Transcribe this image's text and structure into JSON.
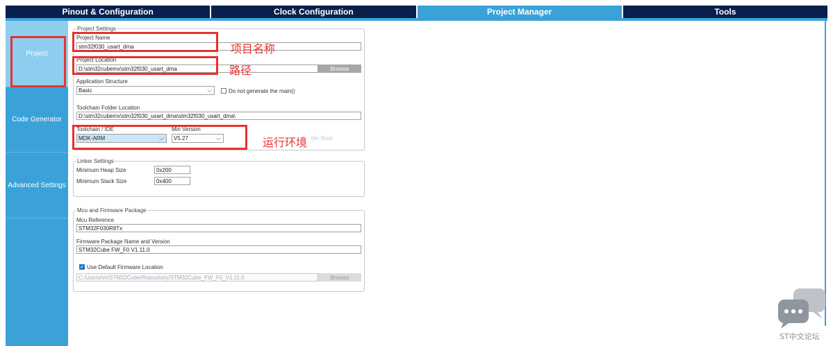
{
  "tabs": [
    {
      "label": "Pinout & Configuration"
    },
    {
      "label": "Clock Configuration"
    },
    {
      "label": "Project Manager"
    },
    {
      "label": "Tools"
    }
  ],
  "sidebar": {
    "items": [
      {
        "label": "Project"
      },
      {
        "label": "Code Generator"
      },
      {
        "label": "Advanced Settings"
      }
    ]
  },
  "project_settings": {
    "legend": "Project Settings",
    "name_label": "Project Name",
    "name_value": "stm32f030_usart_dma",
    "location_label": "Project Location",
    "location_value": "D:\\stm32cubemx\\stm32f030_usart_dma",
    "browse_label": "Browse",
    "app_structure_label": "Application Structure",
    "app_structure_value": "Basic",
    "no_main_label": "Do not generate the main()",
    "toolchain_folder_label": "Toolchain Folder Location",
    "toolchain_folder_value": "D:\\stm32cubemx\\stm32f030_usart_dma\\stm32f030_usart_dma\\",
    "toolchain_label": "Toolchain / IDE",
    "toolchain_value": "MDK-ARM",
    "min_version_label": "Min Version",
    "min_version_value": "V5.27",
    "generate_root_label": "der Root"
  },
  "linker_settings": {
    "legend": "Linker Settings",
    "heap_label": "Minimum Heap Size",
    "heap_value": "0x200",
    "stack_label": "Minimum Stack Size",
    "stack_value": "0x400"
  },
  "mcu_firmware": {
    "legend": "Mcu and Firmware Package",
    "mcu_ref_label": "Mcu Reference",
    "mcu_ref_value": "STM32F030R8Tx",
    "fw_label": "Firmware Package Name and Version",
    "fw_value": "STM32Cube FW_F0 V1.11.0",
    "use_default_label": "Use Default Firmware Location",
    "fw_location_value": "C:/Users/sh/STM32Cube/Repository/STM32Cube_FW_F0_V1.11.0",
    "browse_label": "Browse"
  },
  "annotations": {
    "project_name": "项目名称",
    "path": "路径",
    "run_env": "运行环境"
  },
  "watermark": {
    "text": "ST中文论坛"
  },
  "colors": {
    "tab_bg": "#0b1f4d",
    "accent": "#3aa2d8",
    "annotation_red": "#e8312e"
  }
}
